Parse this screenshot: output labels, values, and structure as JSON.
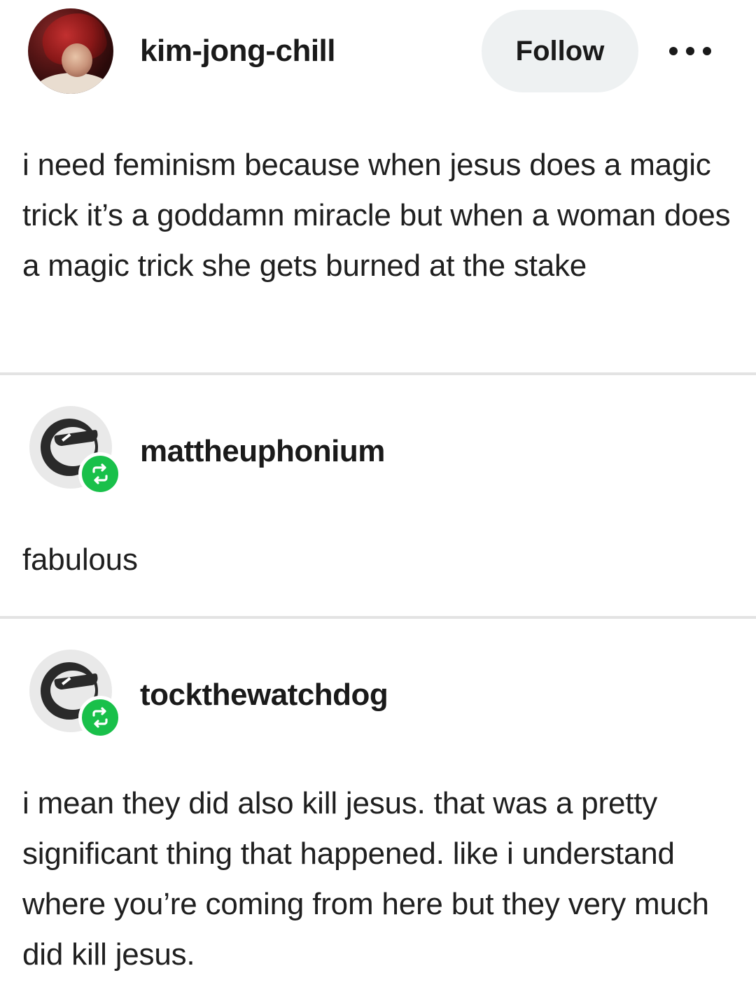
{
  "original_post": {
    "username": "kim-jong-chill",
    "follow_label": "Follow",
    "more_icon": "more-horizontal-icon",
    "text": "i need feminism because when jesus does a magic trick it’s a goddamn miracle but when a woman does a magic trick she gets burned at the stake"
  },
  "reblogs": [
    {
      "username": "mattheuphonium",
      "text": "fabulous",
      "badge_icon": "reblog-icon"
    },
    {
      "username": "tockthewatchdog",
      "text": "i mean they did also kill jesus. that was a pretty significant thing that happened. like i understand where you’re coming from here but they very much did kill jesus.",
      "badge_icon": "reblog-icon"
    }
  ],
  "colors": {
    "reblog_badge": "#19c04a",
    "follow_button_bg": "#eef1f2",
    "divider": "#e3e3e3"
  }
}
